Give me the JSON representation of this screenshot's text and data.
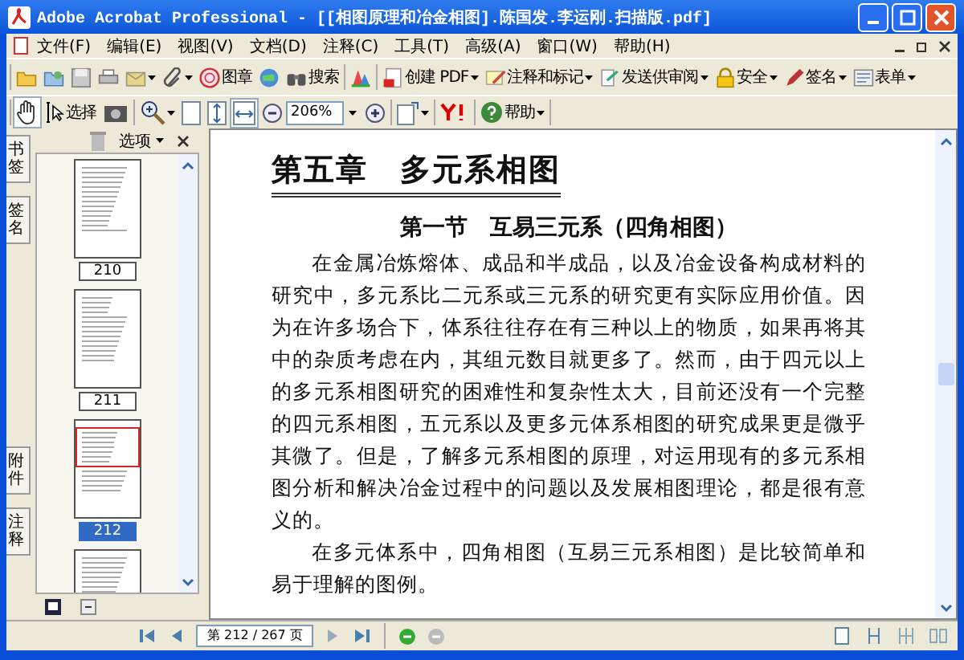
{
  "window": {
    "title": "Adobe Acrobat Professional - [[相图原理和冶金相图].陈国发.李运刚.扫描版.pdf]"
  },
  "menu": [
    "文件(F)",
    "编辑(E)",
    "视图(V)",
    "文档(D)",
    "注释(C)",
    "工具(T)",
    "高级(A)",
    "窗口(W)",
    "帮助(H)"
  ],
  "toolbar_1": [
    [
      {
        "dropdown": false
      },
      {
        "dropdown": false
      },
      {
        "dropdown": false
      },
      {
        "dropdown": false
      },
      {
        "dropdown": true
      },
      {
        "dropdown": true
      },
      {
        "label": "图章",
        "dropdown": false
      },
      {
        "dropdown": false
      },
      {
        "label": "搜索",
        "dropdown": false
      }
    ],
    [
      {
        "dropdown": false
      }
    ],
    [
      {
        "label": "创建 PDF",
        "dropdown": true
      },
      {
        "label": "注释和标记",
        "dropdown": true
      },
      {
        "label": "发送供审阅",
        "dropdown": true
      },
      {
        "label": "安全",
        "dropdown": true
      },
      {
        "label": "签名",
        "dropdown": true
      },
      {
        "label": "表单",
        "dropdown": true
      }
    ]
  ],
  "toolbar_2": {
    "hand_selected": true,
    "select_label": "选择",
    "zoom": "206%",
    "help_label": "帮助"
  },
  "side_tabs": [
    "书签",
    "签名",
    "附件",
    "注释"
  ],
  "panel": {
    "options_label": "选项",
    "thumbnails": [
      {
        "page": "210",
        "selected": false
      },
      {
        "page": "211",
        "selected": false
      },
      {
        "page": "212",
        "selected": true
      },
      {
        "selected": false
      }
    ]
  },
  "document": {
    "chapter_title": "第五章　多元系相图",
    "section_title": "第一节　互易三元系（四角相图）",
    "paragraphs": [
      [
        "在金属冶炼熔体、成品和半成品，以及冶金设备构成材料的",
        "研究中，多元系比二元系或三元系的研究更有实际应用价值。因",
        "为在许多场合下，体系往往存在有三种以上的物质，如果再将其",
        "中的杂质考虑在内，其组元数目就更多了。然而，由于四元以上",
        "的多元系相图研究的困难性和复杂性太大，目前还没有一个完整",
        "的四元系相图，五元系以及更多元体系相图的研究成果更是微乎",
        "其微了。但是，了解多元系相图的原理，对运用现有的多元系相",
        "图分析和解决冶金过程中的问题以及发展相图理论，都是很有意",
        "义的。"
      ],
      [
        "在多元体系中，四角相图（互易三元系相图）是比较简单和",
        "易于理解的图例。"
      ]
    ]
  },
  "status_bar": {
    "page_field": "第 212 / 267 页"
  }
}
